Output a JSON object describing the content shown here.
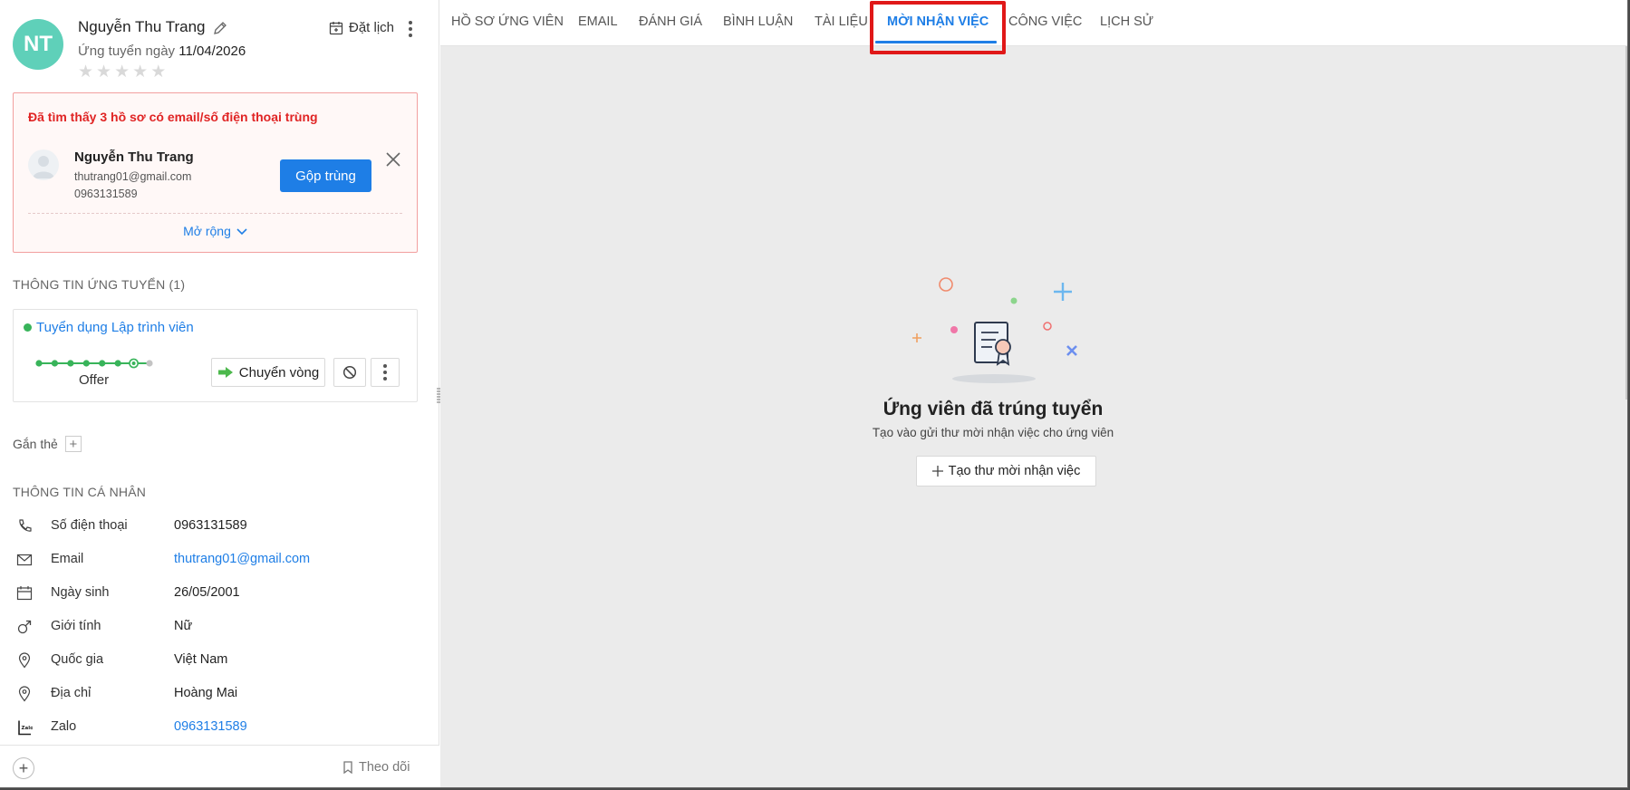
{
  "candidate": {
    "initials": "NT",
    "name": "Nguyễn Thu Trang",
    "applied_label": "Ứng tuyển ngày",
    "applied_date": "11/04/2026",
    "rating": 0,
    "rating_max": 5,
    "schedule_label": "Đặt lịch"
  },
  "duplicate": {
    "title": "Đã tìm thấy 3 hồ sơ có email/số điện thoại trùng",
    "name": "Nguyễn Thu Trang",
    "email": "thutrang01@gmail.com",
    "phone": "0963131589",
    "merge_label": "Gộp trùng",
    "expand_label": "Mở rộng"
  },
  "application": {
    "section_title": "THÔNG TIN ỨNG TUYỂN (1)",
    "job_title": "Tuyển dụng Lập trình viên",
    "stage": "Offer",
    "stages_total": 8,
    "current_stage_index": 7,
    "move_label": "Chuyển vòng"
  },
  "tags": {
    "label": "Gắn thẻ"
  },
  "personal": {
    "section_title": "THÔNG TIN CÁ NHÂN",
    "rows": [
      {
        "icon": "phone-icon",
        "label": "Số điện thoại",
        "value": "0963131589",
        "link": false
      },
      {
        "icon": "mail-icon",
        "label": "Email",
        "value": "thutrang01@gmail.com",
        "link": true
      },
      {
        "icon": "calendar-icon",
        "label": "Ngày sinh",
        "value": "26/05/2001",
        "link": false
      },
      {
        "icon": "gender-icon",
        "label": "Giới tính",
        "value": "Nữ",
        "link": false
      },
      {
        "icon": "location-icon",
        "label": "Quốc gia",
        "value": "Việt Nam",
        "link": false
      },
      {
        "icon": "location-icon",
        "label": "Địa chỉ",
        "value": "Hoàng Mai",
        "link": false
      },
      {
        "icon": "zalo-icon",
        "label": "Zalo",
        "value": "0963131589",
        "link": true
      }
    ]
  },
  "bottom": {
    "follow_label": "Theo dõi"
  },
  "tabs": [
    {
      "label": "HỒ SƠ ỨNG VIÊN",
      "active": false
    },
    {
      "label": "EMAIL",
      "active": false
    },
    {
      "label": "ĐÁNH GIÁ",
      "active": false
    },
    {
      "label": "BÌNH LUẬN",
      "active": false
    },
    {
      "label": "TÀI LIỆU",
      "active": false
    },
    {
      "label": "MỜI NHẬN VIỆC",
      "active": true
    },
    {
      "label": "CÔNG VIỆC",
      "active": false
    },
    {
      "label": "LỊCH SỬ",
      "active": false
    }
  ],
  "empty_state": {
    "title": "Ứng viên đã trúng tuyển",
    "subtitle": "Tạo vào gửi thư mời nhận việc cho ứng viên",
    "button_label": "Tạo thư mời nhận việc"
  },
  "colors": {
    "accent": "#1e7ee6",
    "avatar": "#5fd0b9",
    "alert": "#e02424",
    "stage_done": "#38b45a",
    "highlight": "#e01818"
  }
}
